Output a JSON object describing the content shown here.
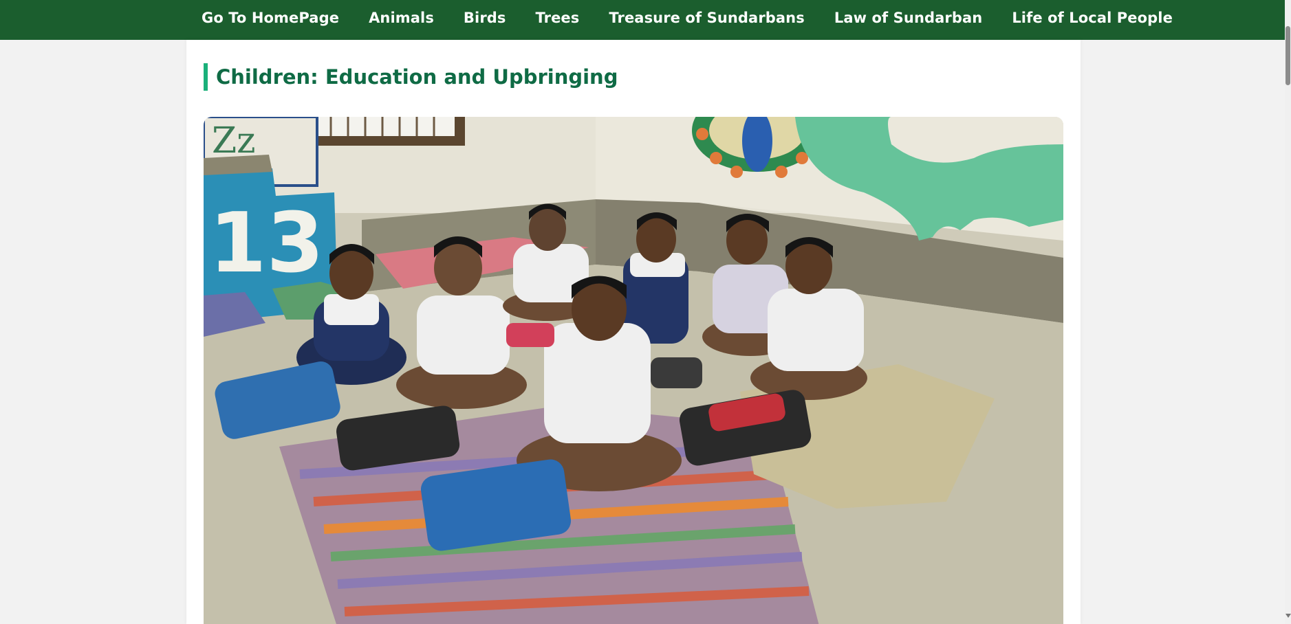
{
  "nav": {
    "items": [
      {
        "label": "Go To HomePage"
      },
      {
        "label": "Animals"
      },
      {
        "label": "Birds"
      },
      {
        "label": "Trees"
      },
      {
        "label": "Treasure of Sundarbans"
      },
      {
        "label": "Law of Sundarban"
      },
      {
        "label": "Life of Local People"
      }
    ],
    "background": "#1b5e2e"
  },
  "section": {
    "title": "Children: Education and Upbringing",
    "accent": "#1ab07a",
    "title_color": "#0f6b45"
  },
  "photo": {
    "text": {
      "wall_letters": "Zz",
      "step_number": "13"
    }
  }
}
